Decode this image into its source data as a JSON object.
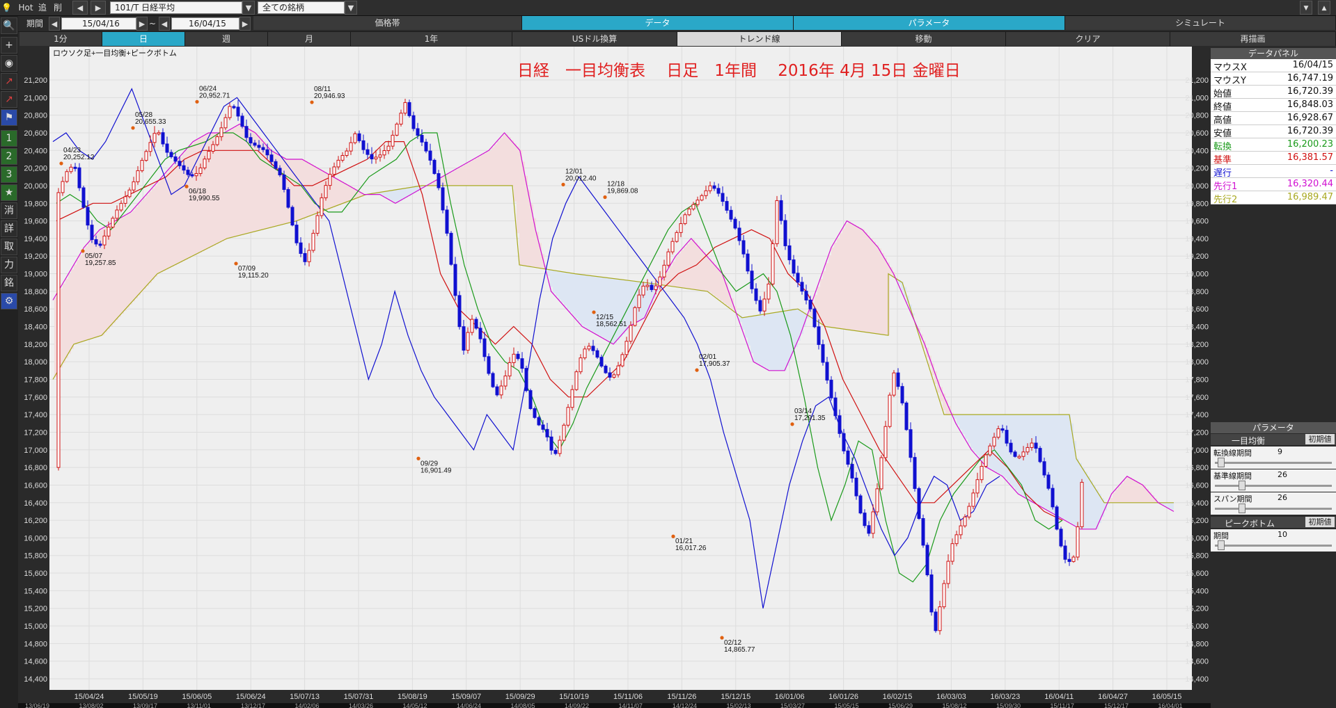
{
  "toolbar": {
    "hot": "Hot",
    "add": "追",
    "del": "削",
    "symbol": "101/T 日経平均",
    "universe": "全ての銘柄",
    "period_label": "期間",
    "date_from": "15/04/16",
    "tilde": "~",
    "date_to": "16/04/15",
    "tab_price": "価格帯",
    "tab_data": "データ",
    "tab_param": "パラメータ",
    "tab_sim": "シミュレート",
    "timeframes": [
      "1分",
      "日",
      "週",
      "月",
      "1年",
      "USドル換算",
      "トレンド線",
      "移動",
      "クリア",
      "再描画"
    ],
    "timeframe_active": "日"
  },
  "left_tools": [
    {
      "icon": "search-icon",
      "glyph": "🔍"
    },
    {
      "icon": "crosshair-icon",
      "glyph": "+"
    },
    {
      "icon": "camera-icon",
      "glyph": "◉"
    },
    {
      "icon": "line-chart-icon",
      "glyph": "↗"
    },
    {
      "icon": "trend-icon",
      "glyph": "↗"
    },
    {
      "icon": "flag-icon",
      "glyph": "⚑"
    },
    {
      "icon": "one-icon",
      "glyph": "1"
    },
    {
      "icon": "two-icon",
      "glyph": "2"
    },
    {
      "icon": "three-icon",
      "glyph": "3"
    },
    {
      "icon": "star-icon",
      "glyph": "★"
    },
    {
      "icon": "erase-icon",
      "glyph": "消"
    },
    {
      "icon": "detail-icon",
      "glyph": "詳"
    },
    {
      "icon": "trade-icon",
      "glyph": "取"
    },
    {
      "icon": "power-icon",
      "glyph": "力"
    },
    {
      "icon": "stock-icon",
      "glyph": "銘"
    },
    {
      "icon": "gear-icon",
      "glyph": "⚙"
    }
  ],
  "chart": {
    "legend_text": "ロウソク足+一目均衡+ピークボトム",
    "title_text": "日経　一目均衡表　 日足　1年間　 2016年 4月 15日 金曜日",
    "title_color": "#e02020",
    "colors": {
      "up": "#d01010",
      "down": "#1010d0",
      "tenkan": "#d01010",
      "kijun": "#d01010",
      "chikou": "#1010d0",
      "senkou1": "#d010d0",
      "senkou2": "#a8a820",
      "kumo_bull": "#f3dede",
      "kumo_bear": "#dde6f3"
    }
  },
  "chart_data": {
    "type": "candlestick",
    "ylim": [
      14400,
      21400
    ],
    "y_ticks": [
      21200,
      21000,
      20800,
      20600,
      20400,
      20200,
      20000,
      19800,
      19600,
      19400,
      19200,
      19000,
      18800,
      18600,
      18400,
      18200,
      18000,
      17800,
      17600,
      17400,
      17200,
      17000,
      16800,
      16600,
      16400,
      16200,
      16000,
      15800,
      15600,
      15400,
      15200,
      15000,
      14800,
      14600,
      14400
    ],
    "x_ticks": [
      "15/04/24",
      "15/05/19",
      "15/06/05",
      "15/06/24",
      "15/07/13",
      "15/07/31",
      "15/08/19",
      "15/09/07",
      "15/09/29",
      "15/10/19",
      "15/11/06",
      "15/11/26",
      "15/12/15",
      "16/01/06",
      "16/01/26",
      "16/02/15",
      "16/03/03",
      "16/03/23",
      "16/04/11",
      "16/04/27",
      "16/05/15"
    ],
    "bottom_ticks": [
      "13/06/19",
      "13/08/02",
      "13/09/17",
      "13/11/01",
      "13/12/17",
      "14/02/06",
      "14/03/26",
      "14/05/12",
      "14/06/24",
      "14/08/05",
      "14/09/22",
      "14/11/07",
      "14/12/24",
      "15/02/13",
      "15/03/27",
      "15/05/15",
      "15/06/29",
      "15/08/12",
      "15/09/30",
      "15/11/17",
      "15/12/17",
      "16/04/01"
    ],
    "peaks": [
      {
        "date": "04/23",
        "value": "20,252.12",
        "price": 20252.12,
        "type": "peak"
      },
      {
        "date": "05/07",
        "value": "19,257.85",
        "price": 19257.85,
        "type": "bottom"
      },
      {
        "date": "05/28",
        "value": "20,655.33",
        "price": 20655.33,
        "type": "peak"
      },
      {
        "date": "06/18",
        "value": "19,990.55",
        "price": 19990.55,
        "type": "bottom"
      },
      {
        "date": "06/24",
        "value": "20,952.71",
        "price": 20952.71,
        "type": "peak"
      },
      {
        "date": "07/09",
        "value": "19,115.20",
        "price": 19115.2,
        "type": "bottom"
      },
      {
        "date": "08/11",
        "value": "20,946.93",
        "price": 20946.93,
        "type": "peak"
      },
      {
        "date": "09/29",
        "value": "16,901.49",
        "price": 16901.49,
        "type": "bottom"
      },
      {
        "date": "12/01",
        "value": "20,012.40",
        "price": 20012.4,
        "type": "peak"
      },
      {
        "date": "12/15",
        "value": "18,562.51",
        "price": 18562.51,
        "type": "bottom"
      },
      {
        "date": "12/18",
        "value": "19,869.08",
        "price": 19869.08,
        "type": "peak"
      },
      {
        "date": "01/21",
        "value": "16,017.26",
        "price": 16017.26,
        "type": "bottom"
      },
      {
        "date": "02/01",
        "value": "17,905.37",
        "price": 17905.37,
        "type": "peak"
      },
      {
        "date": "02/12",
        "value": "14,865.77",
        "price": 14865.77,
        "type": "bottom"
      },
      {
        "date": "03/14",
        "value": "17,291.35",
        "price": 17291.35,
        "type": "peak"
      }
    ],
    "close_path": [
      19900,
      20150,
      20250,
      19800,
      19400,
      19300,
      19500,
      19700,
      19850,
      20000,
      20250,
      20450,
      20655,
      20400,
      20300,
      20200,
      20100,
      20150,
      20350,
      20500,
      20700,
      20952,
      20750,
      20500,
      20450,
      20400,
      20250,
      20100,
      19700,
      19300,
      19115,
      19500,
      19900,
      20150,
      20300,
      20400,
      20600,
      20400,
      20300,
      20350,
      20450,
      20700,
      20946,
      20650,
      20500,
      20300,
      20000,
      19500,
      18800,
      18100,
      18500,
      18300,
      17900,
      17600,
      17800,
      18100,
      18000,
      17500,
      17300,
      17200,
      16901,
      17200,
      17600,
      18000,
      18200,
      18100,
      17900,
      17800,
      18000,
      18300,
      18700,
      18900,
      18800,
      19000,
      19300,
      19500,
      19700,
      19800,
      19900,
      20012,
      19900,
      19700,
      19500,
      19200,
      18800,
      18562,
      18900,
      19869,
      19300,
      19000,
      18800,
      18600,
      18200,
      17800,
      17400,
      17000,
      16700,
      16300,
      16017,
      16500,
      17200,
      17905,
      17600,
      17000,
      16300,
      15700,
      14865,
      15400,
      15900,
      16100,
      16300,
      16600,
      16900,
      17100,
      17291,
      17000,
      16900,
      17000,
      17100,
      16800,
      16500,
      16000,
      15700,
      15800,
      16800
    ],
    "chikou_path": [
      20500,
      20600,
      20400,
      20300,
      20500,
      20800,
      21100,
      20700,
      20300,
      19900,
      20000,
      20300,
      20600,
      20900,
      21000,
      20800,
      20600,
      20400,
      20200,
      20000,
      19800,
      19600,
      19000,
      18400,
      17800,
      18200,
      18800,
      18300,
      17900,
      17600,
      17400,
      17200,
      17000,
      17400,
      17200,
      17000,
      17800,
      18700,
      19400,
      19800,
      20100,
      19900,
      19700,
      19500,
      19300,
      19100,
      18900,
      18700,
      18500,
      18200,
      17800,
      17200,
      16700,
      16200,
      15200,
      15900,
      16600,
      17100,
      17500,
      17600,
      17200,
      16900,
      16500,
      16100,
      15800,
      16000,
      16400,
      16700,
      16600,
      16200,
      16300,
      16600,
      16700
    ],
    "tenkan_path": [
      19800,
      19900,
      19800,
      19600,
      19500,
      19700,
      19900,
      20100,
      20300,
      20400,
      20450,
      20500,
      20600,
      20600,
      20500,
      20300,
      20200,
      20100,
      20000,
      19800,
      19700,
      19700,
      19900,
      20100,
      20200,
      20300,
      20500,
      20600,
      20600,
      19800,
      19100,
      18600,
      18200,
      18000,
      17900,
      17600,
      17200,
      17000,
      17300,
      17700,
      18000,
      18300,
      18600,
      18900,
      19200,
      19500,
      19700,
      19800,
      19400,
      19000,
      18800,
      18900,
      19000,
      18800,
      18300,
      17600,
      16800,
      16200,
      16600,
      17100,
      17000,
      16200,
      15600,
      15500,
      15700,
      16200,
      16500,
      16700,
      16900,
      17000,
      16800,
      16600,
      16200,
      16100,
      16200
    ],
    "kijun_path": [
      19600,
      19700,
      19800,
      19800,
      19900,
      20000,
      20100,
      20300,
      20400,
      20400,
      20400,
      20400,
      20200,
      20000,
      20000,
      20100,
      20200,
      20300,
      20500,
      20500,
      19900,
      19000,
      18600,
      18400,
      18200,
      18400,
      18200,
      17800,
      17600,
      17600,
      17800,
      18000,
      18400,
      18800,
      19000,
      19100,
      19300,
      19400,
      19500,
      19400,
      19000,
      18800,
      18400,
      17800,
      17400,
      17000,
      16700,
      16400,
      16400,
      16600,
      16800,
      17000,
      16800,
      16500,
      16300,
      16200
    ],
    "senkou1_path": [
      18700,
      19000,
      19300,
      19500,
      19600,
      19700,
      19900,
      20100,
      20300,
      20500,
      20600,
      20600,
      20700,
      20600,
      20400,
      20300,
      20300,
      20200,
      20100,
      20000,
      19900,
      19900,
      19800,
      19900,
      20000,
      20100,
      20200,
      20300,
      20400,
      20600,
      20400,
      19500,
      18800,
      18600,
      18400,
      18300,
      18200,
      18400,
      18500,
      18900,
      19200,
      19400,
      19200,
      19000,
      18500,
      18000,
      17900,
      17900,
      18300,
      18800,
      19300,
      19600,
      19500,
      19300,
      19000,
      18600,
      18200,
      17700,
      17300,
      17000,
      16800,
      16700,
      16500,
      16400,
      16300,
      16200,
      16100,
      16100,
      16500,
      16700,
      16600,
      16400,
      16300
    ]
  },
  "data_panel": {
    "title": "データパネル",
    "rows": [
      {
        "k": "マウスX",
        "v": "16/04/15",
        "color": "#111"
      },
      {
        "k": "マウスY",
        "v": "16,747.19",
        "color": "#111"
      },
      {
        "k": "始値",
        "v": "16,720.39",
        "color": "#111"
      },
      {
        "k": "終値",
        "v": "16,848.03",
        "color": "#111"
      },
      {
        "k": "高値",
        "v": "16,928.67",
        "color": "#111"
      },
      {
        "k": "安値",
        "v": "16,720.39",
        "color": "#111"
      },
      {
        "k": "転換",
        "v": "16,200.23",
        "color": "#1a9a1a"
      },
      {
        "k": "基準",
        "v": "16,381.57",
        "color": "#d01010"
      },
      {
        "k": "遅行",
        "v": "-",
        "color": "#1010d0"
      },
      {
        "k": "先行1",
        "v": "16,320.44",
        "color": "#d010d0"
      },
      {
        "k": "先行2",
        "v": "16,989.47",
        "color": "#a8a820"
      }
    ]
  },
  "param_panel": {
    "title": "パラメータ",
    "ichimoku_title": "一目均衡",
    "reset_label": "初期値",
    "tenkan_label": "転換線期間",
    "tenkan_value": "9",
    "kijun_label": "基準線期間",
    "kijun_value": "26",
    "span_label": "スパン期間",
    "span_value": "26",
    "peak_title": "ピークボトム",
    "peak_reset_label": "初期値",
    "peak_period_label": "期間",
    "peak_period_value": "10"
  }
}
